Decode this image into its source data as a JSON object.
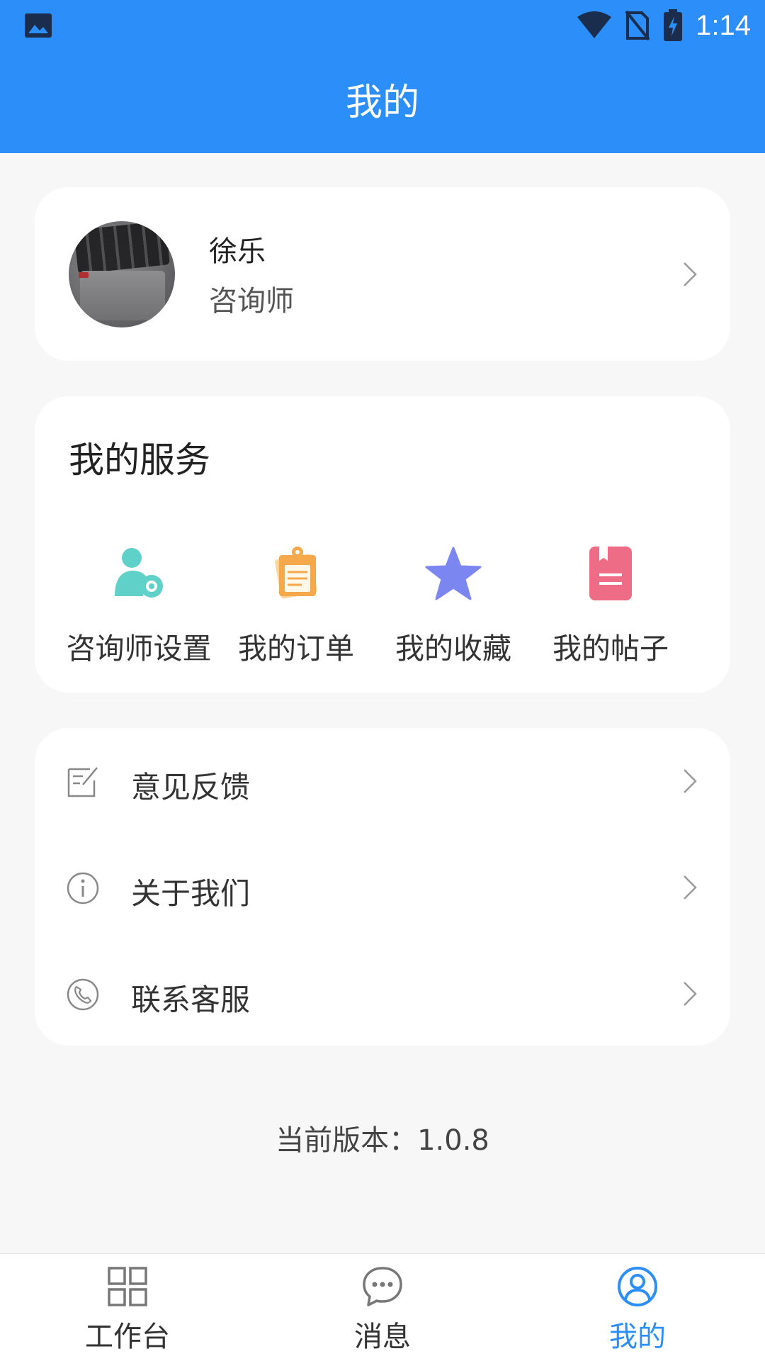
{
  "status_bar": {
    "time": "1:14"
  },
  "header": {
    "title": "我的"
  },
  "profile": {
    "name": "徐乐",
    "role": "咨询师"
  },
  "services": {
    "title": "我的服务",
    "items": [
      {
        "label": "咨询师设置",
        "icon": "consultant-settings-icon",
        "color": "#5fd1c9"
      },
      {
        "label": "我的订单",
        "icon": "orders-icon",
        "color": "#f6a94b"
      },
      {
        "label": "我的收藏",
        "icon": "star-icon",
        "color": "#7b86f0"
      },
      {
        "label": "我的帖子",
        "icon": "posts-icon",
        "color": "#ef6c86"
      }
    ]
  },
  "menu": [
    {
      "label": "意见反馈",
      "icon": "feedback-icon"
    },
    {
      "label": "关于我们",
      "icon": "info-icon"
    },
    {
      "label": "联系客服",
      "icon": "phone-icon"
    }
  ],
  "version": "当前版本：1.0.8",
  "tabbar": {
    "tabs": [
      {
        "label": "工作台",
        "icon": "grid-icon"
      },
      {
        "label": "消息",
        "icon": "chat-bubble-icon"
      },
      {
        "label": "我的",
        "icon": "user-circle-icon",
        "active": true
      }
    ],
    "active_color": "#2b8ef9",
    "inactive_color": "#333333"
  },
  "colors": {
    "primary": "#2b8ef9",
    "background": "#f7f7f7"
  }
}
